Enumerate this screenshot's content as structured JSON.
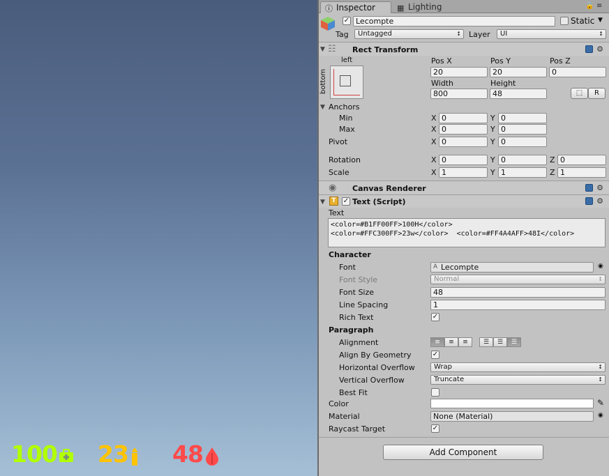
{
  "game_hud": {
    "health": {
      "value": "100",
      "color": "#B1FF00",
      "icon": "medkit-icon"
    },
    "ammo": {
      "value": "23",
      "color": "#FFC300",
      "icon": "bullet-icon"
    },
    "lives": {
      "value": "48",
      "color": "#FF4A4A",
      "icon": "blood-drop-icon"
    }
  },
  "tabs": {
    "inspector": "Inspector",
    "lighting": "Lighting"
  },
  "object": {
    "name": "Lecompte",
    "static_label": "Static",
    "tag_label": "Tag",
    "tag_value": "Untagged",
    "layer_label": "Layer",
    "layer_value": "UI"
  },
  "rect_transform": {
    "title": "Rect Transform",
    "anchor_left": "left",
    "anchor_bottom": "bottom",
    "posx_label": "Pos X",
    "posy_label": "Pos Y",
    "posz_label": "Pos Z",
    "posx": "20",
    "posy": "20",
    "posz": "0",
    "width_label": "Width",
    "height_label": "Height",
    "width": "800",
    "height": "48",
    "r_button": "R",
    "anchors_label": "Anchors",
    "min_label": "Min",
    "max_label": "Max",
    "pivot_label": "Pivot",
    "min_x": "0",
    "min_y": "0",
    "max_x": "0",
    "max_y": "0",
    "pivot_x": "0",
    "pivot_y": "0",
    "rotation_label": "Rotation",
    "scale_label": "Scale",
    "rot_x": "0",
    "rot_y": "0",
    "rot_z": "0",
    "scale_x": "1",
    "scale_y": "1",
    "scale_z": "1",
    "x": "X",
    "y": "Y",
    "z": "Z"
  },
  "canvas_renderer": {
    "title": "Canvas Renderer"
  },
  "text_script": {
    "title": "Text (Script)",
    "text_label": "Text",
    "text_line1": "<color=#B1FF00FF>100H</color>",
    "text_line2": "<color=#FFC300FF>23w</color>  <color=#FF4A4AFF>48I</color>",
    "character_label": "Character",
    "font_label": "Font",
    "font_value": "Lecompte",
    "font_style_label": "Font Style",
    "font_style_value": "Normal",
    "font_size_label": "Font Size",
    "font_size_value": "48",
    "line_spacing_label": "Line Spacing",
    "line_spacing_value": "1",
    "rich_text_label": "Rich Text",
    "paragraph_label": "Paragraph",
    "alignment_label": "Alignment",
    "align_geometry_label": "Align By Geometry",
    "h_overflow_label": "Horizontal Overflow",
    "h_overflow_value": "Wrap",
    "v_overflow_label": "Vertical Overflow",
    "v_overflow_value": "Truncate",
    "best_fit_label": "Best Fit",
    "color_label": "Color",
    "material_label": "Material",
    "material_value": "None (Material)",
    "raycast_label": "Raycast Target"
  },
  "add_component": "Add Component"
}
